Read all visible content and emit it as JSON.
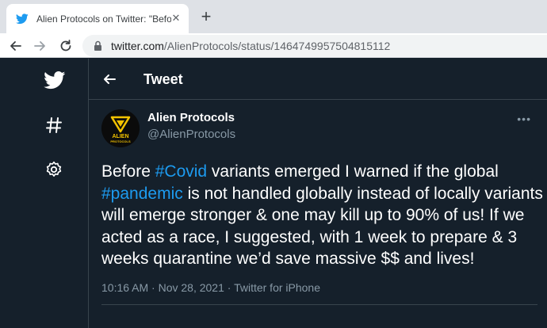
{
  "browser": {
    "tab_title": "Alien Protocols on Twitter: \"Before",
    "tab_close": "✕",
    "new_tab": "+",
    "url_host": "twitter.com",
    "url_path": "/AlienProtocols/status/1464749957504815112"
  },
  "twitter": {
    "header_title": "Tweet",
    "author_name": "Alien Protocols",
    "author_handle": "@AlienProtocols",
    "avatar_text_1": "ALIEN",
    "avatar_text_2": "PROTOCOLS",
    "more_label": "•••",
    "tweet": {
      "part1": "Before ",
      "hashtag1": "#Covid",
      "part2": " variants emerged I warned if the global ",
      "hashtag2": "#pandemic",
      "part3": " is not handled globally instead of locally variants will emerge stronger & one may kill up to 90% of us! If we acted as a race, I suggested, with 1 week to prepare & 3 weeks quarantine we’d save massive $$ and lives!"
    },
    "meta": "10:16 AM · Nov 28, 2021 · Twitter for iPhone"
  },
  "colors": {
    "background": "#15202b",
    "accent": "#1d9bf0",
    "muted": "#8899a6",
    "avatar_gold": "#f2c200"
  },
  "icons": [
    "twitter-bird-icon",
    "hashtag-icon",
    "gear-icon",
    "back-arrow-icon",
    "more-icon",
    "lock-icon",
    "reload-icon"
  ]
}
